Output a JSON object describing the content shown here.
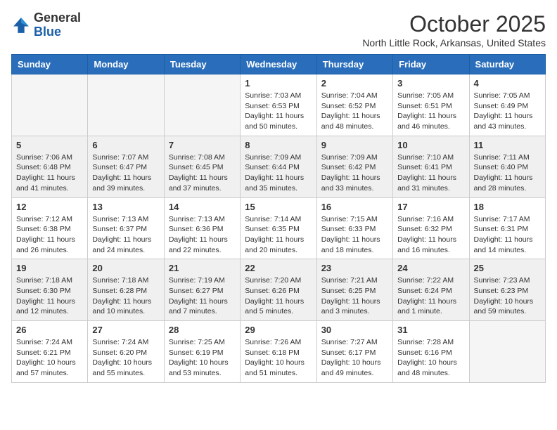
{
  "logo": {
    "general": "General",
    "blue": "Blue"
  },
  "header": {
    "month": "October 2025",
    "location": "North Little Rock, Arkansas, United States"
  },
  "weekdays": [
    "Sunday",
    "Monday",
    "Tuesday",
    "Wednesday",
    "Thursday",
    "Friday",
    "Saturday"
  ],
  "weeks": [
    {
      "shaded": false,
      "days": [
        {
          "num": "",
          "info": ""
        },
        {
          "num": "",
          "info": ""
        },
        {
          "num": "",
          "info": ""
        },
        {
          "num": "1",
          "info": "Sunrise: 7:03 AM\nSunset: 6:53 PM\nDaylight: 11 hours\nand 50 minutes."
        },
        {
          "num": "2",
          "info": "Sunrise: 7:04 AM\nSunset: 6:52 PM\nDaylight: 11 hours\nand 48 minutes."
        },
        {
          "num": "3",
          "info": "Sunrise: 7:05 AM\nSunset: 6:51 PM\nDaylight: 11 hours\nand 46 minutes."
        },
        {
          "num": "4",
          "info": "Sunrise: 7:05 AM\nSunset: 6:49 PM\nDaylight: 11 hours\nand 43 minutes."
        }
      ]
    },
    {
      "shaded": true,
      "days": [
        {
          "num": "5",
          "info": "Sunrise: 7:06 AM\nSunset: 6:48 PM\nDaylight: 11 hours\nand 41 minutes."
        },
        {
          "num": "6",
          "info": "Sunrise: 7:07 AM\nSunset: 6:47 PM\nDaylight: 11 hours\nand 39 minutes."
        },
        {
          "num": "7",
          "info": "Sunrise: 7:08 AM\nSunset: 6:45 PM\nDaylight: 11 hours\nand 37 minutes."
        },
        {
          "num": "8",
          "info": "Sunrise: 7:09 AM\nSunset: 6:44 PM\nDaylight: 11 hours\nand 35 minutes."
        },
        {
          "num": "9",
          "info": "Sunrise: 7:09 AM\nSunset: 6:42 PM\nDaylight: 11 hours\nand 33 minutes."
        },
        {
          "num": "10",
          "info": "Sunrise: 7:10 AM\nSunset: 6:41 PM\nDaylight: 11 hours\nand 31 minutes."
        },
        {
          "num": "11",
          "info": "Sunrise: 7:11 AM\nSunset: 6:40 PM\nDaylight: 11 hours\nand 28 minutes."
        }
      ]
    },
    {
      "shaded": false,
      "days": [
        {
          "num": "12",
          "info": "Sunrise: 7:12 AM\nSunset: 6:38 PM\nDaylight: 11 hours\nand 26 minutes."
        },
        {
          "num": "13",
          "info": "Sunrise: 7:13 AM\nSunset: 6:37 PM\nDaylight: 11 hours\nand 24 minutes."
        },
        {
          "num": "14",
          "info": "Sunrise: 7:13 AM\nSunset: 6:36 PM\nDaylight: 11 hours\nand 22 minutes."
        },
        {
          "num": "15",
          "info": "Sunrise: 7:14 AM\nSunset: 6:35 PM\nDaylight: 11 hours\nand 20 minutes."
        },
        {
          "num": "16",
          "info": "Sunrise: 7:15 AM\nSunset: 6:33 PM\nDaylight: 11 hours\nand 18 minutes."
        },
        {
          "num": "17",
          "info": "Sunrise: 7:16 AM\nSunset: 6:32 PM\nDaylight: 11 hours\nand 16 minutes."
        },
        {
          "num": "18",
          "info": "Sunrise: 7:17 AM\nSunset: 6:31 PM\nDaylight: 11 hours\nand 14 minutes."
        }
      ]
    },
    {
      "shaded": true,
      "days": [
        {
          "num": "19",
          "info": "Sunrise: 7:18 AM\nSunset: 6:30 PM\nDaylight: 11 hours\nand 12 minutes."
        },
        {
          "num": "20",
          "info": "Sunrise: 7:18 AM\nSunset: 6:28 PM\nDaylight: 11 hours\nand 10 minutes."
        },
        {
          "num": "21",
          "info": "Sunrise: 7:19 AM\nSunset: 6:27 PM\nDaylight: 11 hours\nand 7 minutes."
        },
        {
          "num": "22",
          "info": "Sunrise: 7:20 AM\nSunset: 6:26 PM\nDaylight: 11 hours\nand 5 minutes."
        },
        {
          "num": "23",
          "info": "Sunrise: 7:21 AM\nSunset: 6:25 PM\nDaylight: 11 hours\nand 3 minutes."
        },
        {
          "num": "24",
          "info": "Sunrise: 7:22 AM\nSunset: 6:24 PM\nDaylight: 11 hours\nand 1 minute."
        },
        {
          "num": "25",
          "info": "Sunrise: 7:23 AM\nSunset: 6:23 PM\nDaylight: 10 hours\nand 59 minutes."
        }
      ]
    },
    {
      "shaded": false,
      "days": [
        {
          "num": "26",
          "info": "Sunrise: 7:24 AM\nSunset: 6:21 PM\nDaylight: 10 hours\nand 57 minutes."
        },
        {
          "num": "27",
          "info": "Sunrise: 7:24 AM\nSunset: 6:20 PM\nDaylight: 10 hours\nand 55 minutes."
        },
        {
          "num": "28",
          "info": "Sunrise: 7:25 AM\nSunset: 6:19 PM\nDaylight: 10 hours\nand 53 minutes."
        },
        {
          "num": "29",
          "info": "Sunrise: 7:26 AM\nSunset: 6:18 PM\nDaylight: 10 hours\nand 51 minutes."
        },
        {
          "num": "30",
          "info": "Sunrise: 7:27 AM\nSunset: 6:17 PM\nDaylight: 10 hours\nand 49 minutes."
        },
        {
          "num": "31",
          "info": "Sunrise: 7:28 AM\nSunset: 6:16 PM\nDaylight: 10 hours\nand 48 minutes."
        },
        {
          "num": "",
          "info": ""
        }
      ]
    }
  ]
}
